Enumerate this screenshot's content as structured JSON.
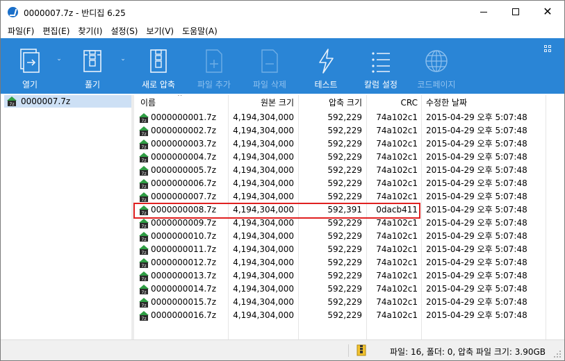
{
  "window": {
    "title": "0000007.7z - 반디집 6.25"
  },
  "menu": [
    "파일(F)",
    "편집(E)",
    "찾기(I)",
    "설정(S)",
    "보기(V)",
    "도움말(A)"
  ],
  "toolbar": {
    "open": "열기",
    "extract": "풀기",
    "new_archive": "새로 압축",
    "add_file": "파일 추가",
    "delete_file": "파일 삭제",
    "test": "테스트",
    "column_settings": "칼럼 설정",
    "codepage": "코드페이지"
  },
  "tree": {
    "root": "0000007.7z"
  },
  "columns": {
    "name": "이름",
    "original_size": "원본 크기",
    "compressed_size": "압축 크기",
    "crc": "CRC",
    "modified": "수정한 날짜"
  },
  "files": [
    {
      "name": "0000000001.7z",
      "original": "4,194,304,000",
      "compressed": "592,229",
      "crc": "74a102c1",
      "date": "2015-04-29 오후 5:07:48"
    },
    {
      "name": "0000000002.7z",
      "original": "4,194,304,000",
      "compressed": "592,229",
      "crc": "74a102c1",
      "date": "2015-04-29 오후 5:07:48"
    },
    {
      "name": "0000000003.7z",
      "original": "4,194,304,000",
      "compressed": "592,229",
      "crc": "74a102c1",
      "date": "2015-04-29 오후 5:07:48"
    },
    {
      "name": "0000000004.7z",
      "original": "4,194,304,000",
      "compressed": "592,229",
      "crc": "74a102c1",
      "date": "2015-04-29 오후 5:07:48"
    },
    {
      "name": "0000000005.7z",
      "original": "4,194,304,000",
      "compressed": "592,229",
      "crc": "74a102c1",
      "date": "2015-04-29 오후 5:07:48"
    },
    {
      "name": "0000000006.7z",
      "original": "4,194,304,000",
      "compressed": "592,229",
      "crc": "74a102c1",
      "date": "2015-04-29 오후 5:07:48"
    },
    {
      "name": "0000000007.7z",
      "original": "4,194,304,000",
      "compressed": "592,229",
      "crc": "74a102c1",
      "date": "2015-04-29 오후 5:07:48"
    },
    {
      "name": "0000000008.7z",
      "original": "4,194,304,000",
      "compressed": "592,391",
      "crc": "0dacb411",
      "date": "2015-04-29 오후 5:07:48"
    },
    {
      "name": "0000000009.7z",
      "original": "4,194,304,000",
      "compressed": "592,229",
      "crc": "74a102c1",
      "date": "2015-04-29 오후 5:07:48"
    },
    {
      "name": "0000000010.7z",
      "original": "4,194,304,000",
      "compressed": "592,229",
      "crc": "74a102c1",
      "date": "2015-04-29 오후 5:07:48"
    },
    {
      "name": "0000000011.7z",
      "original": "4,194,304,000",
      "compressed": "592,229",
      "crc": "74a102c1",
      "date": "2015-04-29 오후 5:07:48"
    },
    {
      "name": "0000000012.7z",
      "original": "4,194,304,000",
      "compressed": "592,229",
      "crc": "74a102c1",
      "date": "2015-04-29 오후 5:07:48"
    },
    {
      "name": "0000000013.7z",
      "original": "4,194,304,000",
      "compressed": "592,229",
      "crc": "74a102c1",
      "date": "2015-04-29 오후 5:07:48"
    },
    {
      "name": "0000000014.7z",
      "original": "4,194,304,000",
      "compressed": "592,229",
      "crc": "74a102c1",
      "date": "2015-04-29 오후 5:07:48"
    },
    {
      "name": "0000000015.7z",
      "original": "4,194,304,000",
      "compressed": "592,229",
      "crc": "74a102c1",
      "date": "2015-04-29 오후 5:07:48"
    },
    {
      "name": "0000000016.7z",
      "original": "4,194,304,000",
      "compressed": "592,229",
      "crc": "74a102c1",
      "date": "2015-04-29 오후 5:07:48"
    }
  ],
  "status": {
    "summary": "파일: 16, 폴더: 0, 압축 파일 크기: 3.90GB"
  },
  "colors": {
    "toolbar_bg": "#2a85d6",
    "highlight_border": "#e02020",
    "selected_bg": "#cde0f5"
  },
  "icons": {
    "app": "bandizip-icon",
    "archive": "7z-archive-icon"
  }
}
